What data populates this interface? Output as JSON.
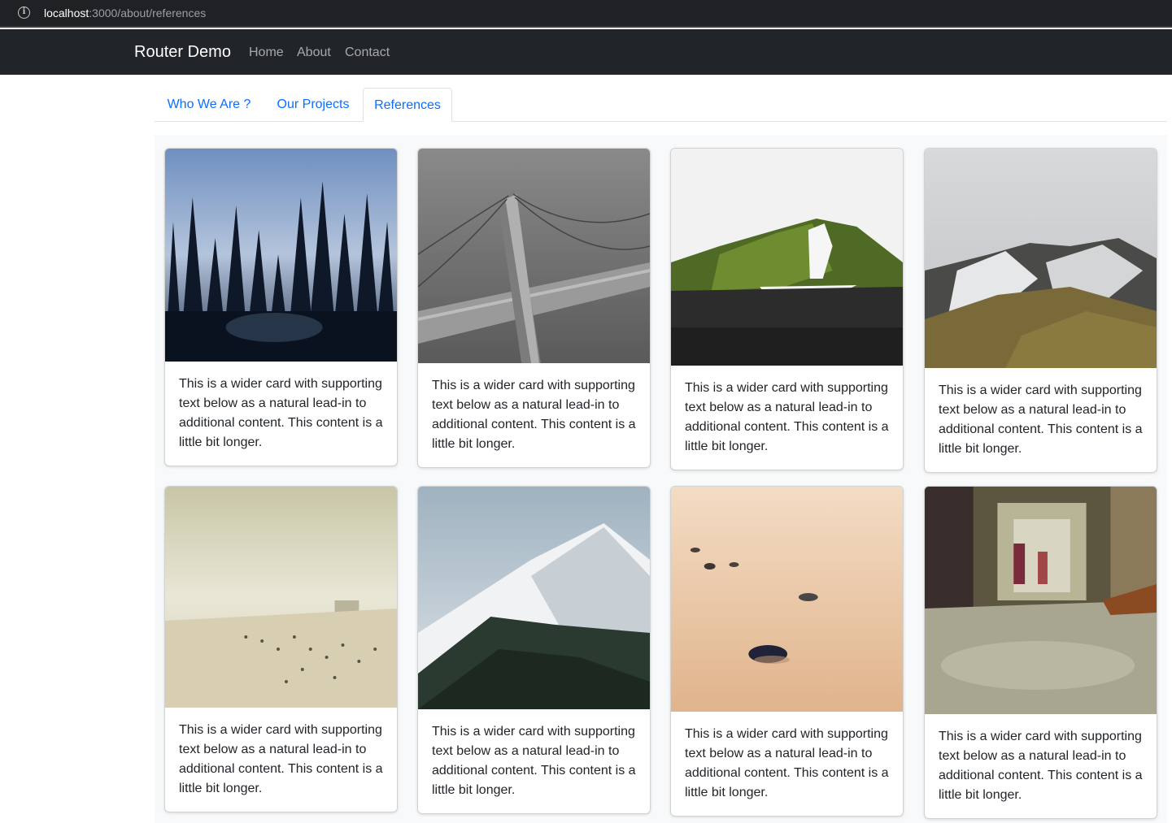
{
  "browser": {
    "url_host": "localhost",
    "url_rest": ":3000/about/references",
    "info_icon": "info-icon"
  },
  "navbar": {
    "brand": "Router Demo",
    "links": [
      "Home",
      "About",
      "Contact"
    ]
  },
  "tabs": [
    {
      "label": "Who We Are ?",
      "active": false
    },
    {
      "label": "Our Projects",
      "active": false
    },
    {
      "label": "References",
      "active": true
    }
  ],
  "cards": [
    {
      "image": "forest-trees-image",
      "text": "This is a wider card with supporting text below as a natural lead-in to additional content. This content is a little bit longer."
    },
    {
      "image": "bridge-tower-image",
      "text": "This is a wider card with supporting text below as a natural lead-in to additional content. This content is a little bit longer."
    },
    {
      "image": "green-mountain-image",
      "text": "This is a wider card with supporting text below as a natural lead-in to additional content. This content is a little bit longer."
    },
    {
      "image": "rocky-mountain-image",
      "text": "This is a wider card with supporting text below as a natural lead-in to additional content. This content is a little bit longer."
    },
    {
      "image": "beach-crowd-image",
      "text": "This is a wider card with supporting text below as a natural lead-in to additional content. This content is a little bit longer."
    },
    {
      "image": "snowy-peak-image",
      "text": "This is a wider card with supporting text below as a natural lead-in to additional content. This content is a little bit longer."
    },
    {
      "image": "sand-pebbles-image",
      "text": "This is a wider card with supporting text below as a natural lead-in to additional content. This content is a little bit longer."
    },
    {
      "image": "subway-train-image",
      "text": "This is a wider card with supporting text below as a natural lead-in to additional content. This content is a little bit longer."
    }
  ]
}
